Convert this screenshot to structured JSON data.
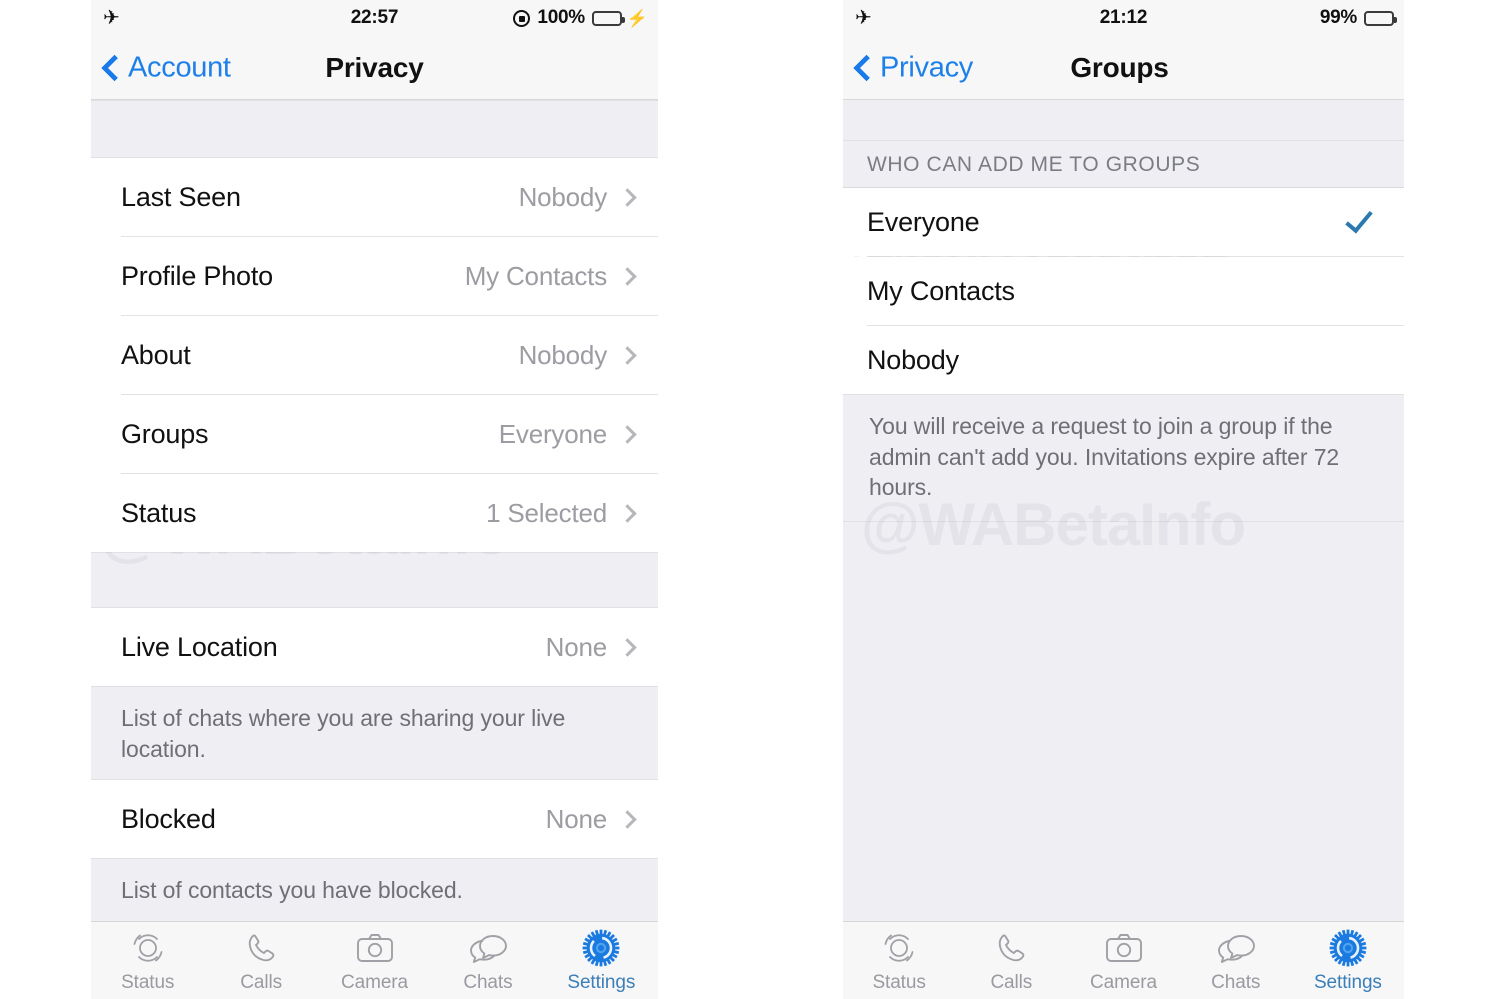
{
  "left_phone": {
    "status_bar": {
      "airplane_icon": "airplane-mode-icon",
      "time": "22:57",
      "rotation_lock_icon": "rotation-lock-icon",
      "battery_percent": "100%",
      "battery_icon": "battery-full-green-icon",
      "charging_icon": "lightning-bolt-icon"
    },
    "nav": {
      "back_label": "Account",
      "back_icon": "chevron-left-icon",
      "title": "Privacy"
    },
    "rows": [
      {
        "label": "Last Seen",
        "value": "Nobody"
      },
      {
        "label": "Profile Photo",
        "value": "My Contacts"
      },
      {
        "label": "About",
        "value": "Nobody"
      },
      {
        "label": "Groups",
        "value": "Everyone"
      },
      {
        "label": "Status",
        "value": "1 Selected"
      }
    ],
    "rows2": [
      {
        "label": "Live Location",
        "value": "None"
      }
    ],
    "note1": "List of chats where you are sharing your live location.",
    "rows3": [
      {
        "label": "Blocked",
        "value": "None"
      }
    ],
    "note2": "List of contacts you have blocked.",
    "watermark": "@WABetaInfo",
    "tabs": [
      {
        "label": "Status",
        "icon": "status-rings-icon",
        "active": false
      },
      {
        "label": "Calls",
        "icon": "phone-icon",
        "active": false
      },
      {
        "label": "Camera",
        "icon": "camera-icon",
        "active": false
      },
      {
        "label": "Chats",
        "icon": "chat-bubbles-icon",
        "active": false
      },
      {
        "label": "Settings",
        "icon": "gear-icon",
        "active": true
      }
    ]
  },
  "right_phone": {
    "status_bar": {
      "airplane_icon": "airplane-mode-icon",
      "time": "21:12",
      "battery_percent": "99%",
      "battery_icon": "battery-full-dark-icon"
    },
    "nav": {
      "back_label": "Privacy",
      "back_icon": "chevron-left-icon",
      "title": "Groups"
    },
    "section_header": "WHO CAN ADD ME TO GROUPS",
    "options": [
      {
        "label": "Everyone",
        "selected": true
      },
      {
        "label": "My Contacts",
        "selected": false
      },
      {
        "label": "Nobody",
        "selected": false
      }
    ],
    "footer_note": "You will receive a request to join a group if the admin can't add you. Invitations expire after 72 hours.",
    "watermark": "@WABetaInfo",
    "tabs": [
      {
        "label": "Status",
        "icon": "status-rings-icon",
        "active": false
      },
      {
        "label": "Calls",
        "icon": "phone-icon",
        "active": false
      },
      {
        "label": "Camera",
        "icon": "camera-icon",
        "active": false
      },
      {
        "label": "Chats",
        "icon": "chat-bubbles-icon",
        "active": false
      },
      {
        "label": "Settings",
        "icon": "gear-icon",
        "active": true
      }
    ]
  },
  "colors": {
    "accent_blue": "#1d80e8",
    "check_blue": "#2c79ad",
    "active_tab": "#3b7fb8",
    "battery_green": "#4cd964",
    "gray_band": "#eeeef3"
  }
}
